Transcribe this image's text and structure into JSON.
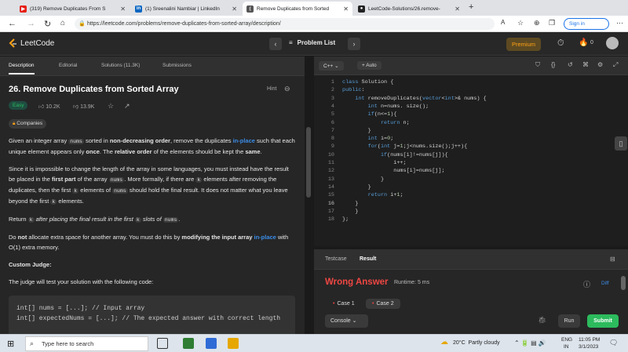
{
  "browser": {
    "tabs": [
      {
        "label": "(319) Remove Duplicates From S",
        "icon": "youtube-icon"
      },
      {
        "label": "(1) Sreenalini Nambiar | LinkedIn",
        "icon": "linkedin-icon"
      },
      {
        "label": "Remove Duplicates from Sorted",
        "icon": "leetcode-icon"
      },
      {
        "label": "LeetCode-Solutions/26.remove-",
        "icon": "github-icon"
      }
    ],
    "url": "https://leetcode.com/problems/remove-duplicates-from-sorted-array/description/",
    "sign_in": "Sign in"
  },
  "leetcode": {
    "logo": "LeetCode",
    "problem_list": "Problem List",
    "premium": "Premium",
    "notifications": "0"
  },
  "left_tabs": [
    "Description",
    "Editorial",
    "Solutions (11.3K)",
    "Submissions"
  ],
  "problem": {
    "title": "26. Remove Duplicates from Sorted Array",
    "hint": "Hint",
    "difficulty": "Easy",
    "likes": "10.2K",
    "dislikes": "13.9K",
    "companies": "Companies",
    "p1a": "Given an integer array ",
    "p1b": "nums",
    "p1c": " sorted in ",
    "p1d": "non-decreasing order",
    "p1e": ", remove the duplicates ",
    "p1f": "in-place",
    "p1g": " such that each unique element appears only ",
    "p1h": "once",
    "p1i": ". The ",
    "p1j": "relative order",
    "p1k": " of the elements should be kept the ",
    "p1l": "same",
    "p1m": ".",
    "p2a": "Since it is impossible to change the length of the array in some languages, you must instead have the result be placed in the ",
    "p2b": "first part",
    "p2c": " of the array ",
    "p2d": "nums",
    "p2e": ". More formally, if there are ",
    "p2f": "k",
    "p2g": " elements after removing the duplicates, then the first ",
    "p2h": "k",
    "p2i": " elements of ",
    "p2j": "nums",
    "p2k": " should hold the final result. It does not matter what you leave beyond the first ",
    "p2l": "k",
    "p2m": " elements.",
    "p3a": "Return ",
    "p3b": "k",
    "p3c": " after placing the final result in the first ",
    "p3d": "k",
    "p3e": " slots of ",
    "p3f": "nums",
    "p3g": ".",
    "p4a": "Do ",
    "p4b": "not",
    "p4c": " allocate extra space for another array. You must do this by ",
    "p4d": "modifying the input array",
    "p4e": " ",
    "p4f": "in-place",
    "p4g": " with O(1) extra memory.",
    "custom_judge": "Custom Judge:",
    "judge_text": "The judge will test your solution with the following code:",
    "judge_code": [
      "int[] nums = [...]; // Input array",
      "int[] expectedNums = [...]; // The expected answer with correct length"
    ]
  },
  "editor": {
    "language": "C++",
    "auto": "Auto",
    "lines": [
      "class Solution {",
      "public:",
      "    int removeDuplicates(vector<int>& nums) {",
      "        int n=nums. size();",
      "        if(n<=1){",
      "            return n;",
      "        }",
      "        int i=0;",
      "        for(int j=1;j<nums.size();j++){",
      "            if(nums[i]!=nums[j]){",
      "                i++;",
      "                nums[i]=nums[j];",
      "            }",
      "        }",
      "        return i+1;",
      "    }",
      "    }",
      "};"
    ]
  },
  "result": {
    "tabs": [
      "Testcase",
      "Result"
    ],
    "verdict": "Wrong Answer",
    "runtime": "Runtime: 5 ms",
    "diff": "Diff",
    "cases": [
      "Case 1",
      "Case 2"
    ],
    "console": "Console",
    "run": "Run",
    "submit": "Submit"
  },
  "taskbar": {
    "search": "Type here to search",
    "weather": "20°C  Partly cloudy",
    "lang1": "ENG",
    "lang2": "IN",
    "time": "11:05 PM",
    "date": "3/1/2023"
  }
}
